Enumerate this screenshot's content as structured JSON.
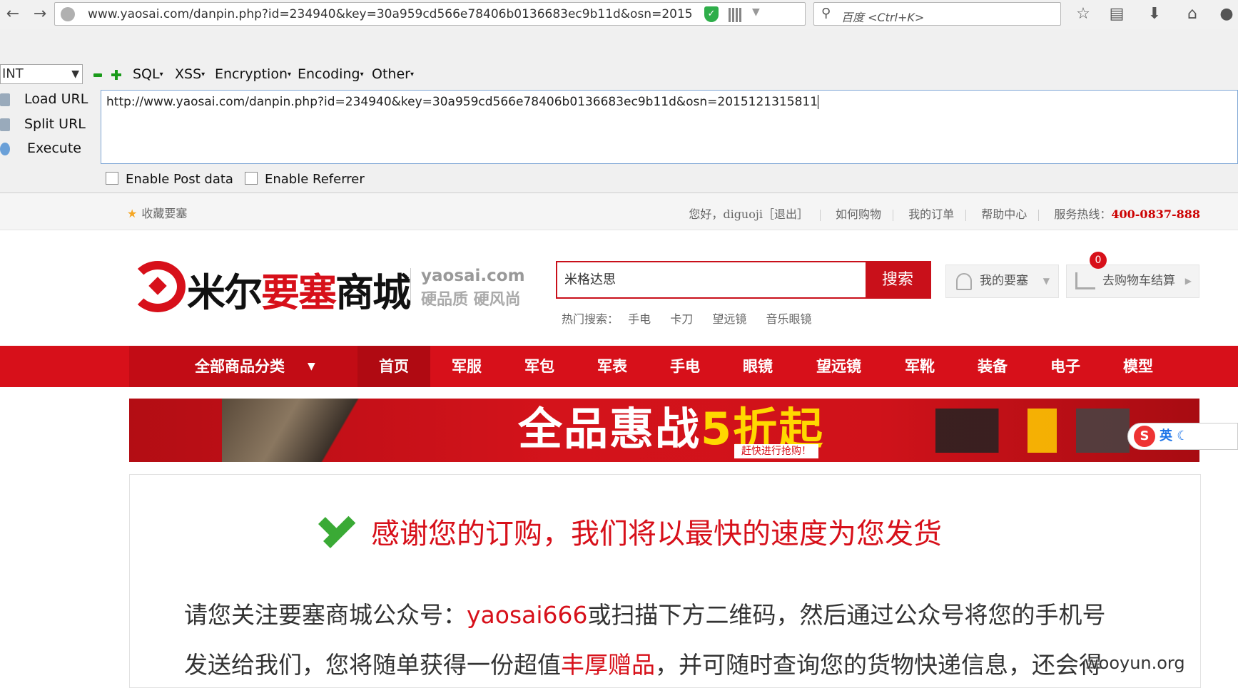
{
  "browser": {
    "url": "www.yaosai.com/danpin.php?id=234940&key=30a959cd566e78406b0136683ec9b11d&osn=2015",
    "search_placeholder": "百度 <Ctrl+K>"
  },
  "hackbar": {
    "select_value": "INT",
    "menus": [
      "SQL",
      "XSS",
      "Encryption",
      "Encoding",
      "Other"
    ],
    "actions": [
      "Load URL",
      "Split URL",
      "Execute"
    ],
    "url_value": "http://www.yaosai.com/danpin.php?id=234940&key=30a959cd566e78406b0136683ec9b11d&osn=2015121315811",
    "checkboxes": [
      "Enable Post data",
      "Enable Referrer"
    ]
  },
  "site_topbar": {
    "favorite": "收藏要塞",
    "greeting": "您好，diguoji［退出］",
    "links": [
      "如何购物",
      "我的订单",
      "帮助中心"
    ],
    "hotline_label": "服务热线：",
    "hotline": "400-0837-888"
  },
  "header": {
    "logo_cn_black": "米尔",
    "logo_cn_red": "要塞",
    "logo_cn_black2": "商城",
    "logo_en": "yaosai.com",
    "logo_slogan": "硬品质 硬风尚",
    "search_value": "米格达思",
    "search_button": "搜索",
    "hot_label": "热门搜索：",
    "hot_words": [
      "手电",
      "卡刀",
      "望远镜",
      "音乐眼镜"
    ],
    "my_button": "我的要塞",
    "cart_button": "去购物车结算",
    "cart_count": "0"
  },
  "nav": {
    "all_categories": "全部商品分类",
    "items": [
      "首页",
      "军服",
      "军包",
      "军表",
      "手电",
      "眼镜",
      "望远镜",
      "军靴",
      "装备",
      "电子",
      "模型"
    ]
  },
  "banner": {
    "headline": "全品惠战",
    "headline_yellow": "5折起",
    "sub": "赶快进行抢购！",
    "ime": "英"
  },
  "content": {
    "thanks": "感谢您的订购，我们将以最快的速度为您发货",
    "line1_a": "请您关注要塞商城公众号：",
    "line1_red": "yaosai666",
    "line1_b": "或扫描下方二维码，然后通过公众号将您的手机号",
    "line2_a": "发送给我们，您将随单获得一份超值",
    "line2_red": "丰厚赠品",
    "line2_b": "，并可随时查询您的货物快递信息，还会得"
  },
  "watermark": "wooyun.org"
}
